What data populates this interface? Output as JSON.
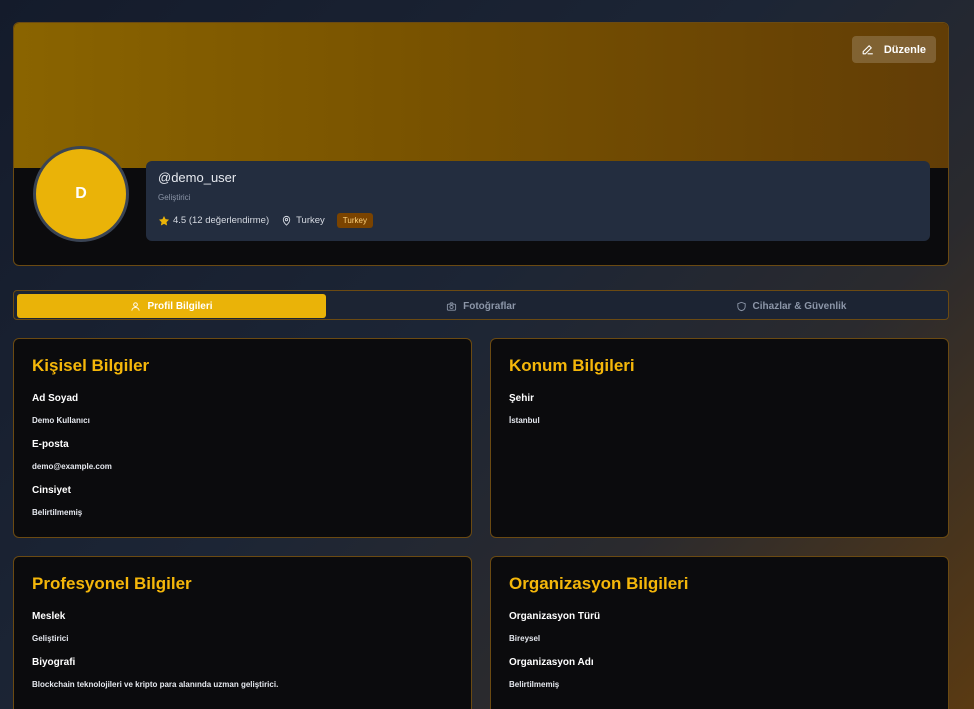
{
  "profile": {
    "edit_label": "Düzenle",
    "avatar_initial": "D",
    "username": "@demo_user",
    "role": "Geliştirici",
    "rating_text": "4.5 (12 değerlendirme)",
    "location": "Turkey",
    "badge": "Turkey"
  },
  "tabs": [
    {
      "label": "Profil Bilgileri",
      "icon": "user-icon",
      "active": true
    },
    {
      "label": "Fotoğraflar",
      "icon": "camera-icon",
      "active": false
    },
    {
      "label": "Cihazlar & Güvenlik",
      "icon": "shield-icon",
      "active": false
    }
  ],
  "personal": {
    "title": "Kişisel Bilgiler",
    "fields": [
      {
        "label": "Ad Soyad",
        "value": "Demo Kullanıcı"
      },
      {
        "label": "E-posta",
        "value": "demo@example.com"
      },
      {
        "label": "Cinsiyet",
        "value": "Belirtilmemiş"
      }
    ]
  },
  "location_info": {
    "title": "Konum Bilgileri",
    "fields": [
      {
        "label": "Şehir",
        "value": "İstanbul"
      }
    ]
  },
  "professional": {
    "title": "Profesyonel Bilgiler",
    "fields": [
      {
        "label": "Meslek",
        "value": "Geliştirici"
      },
      {
        "label": "Biyografi",
        "value": "Blockchain teknolojileri ve kripto para alanında uzman geliştirici."
      }
    ]
  },
  "organization": {
    "title": "Organizasyon Bilgileri",
    "fields": [
      {
        "label": "Organizasyon Türü",
        "value": "Bireysel"
      },
      {
        "label": "Organizasyon Adı",
        "value": "Belirtilmemiş"
      }
    ]
  },
  "colors": {
    "accent": "#eab308",
    "heading": "#f5b70a",
    "border": "#6b4a12",
    "badge_bg": "#7a4300"
  }
}
